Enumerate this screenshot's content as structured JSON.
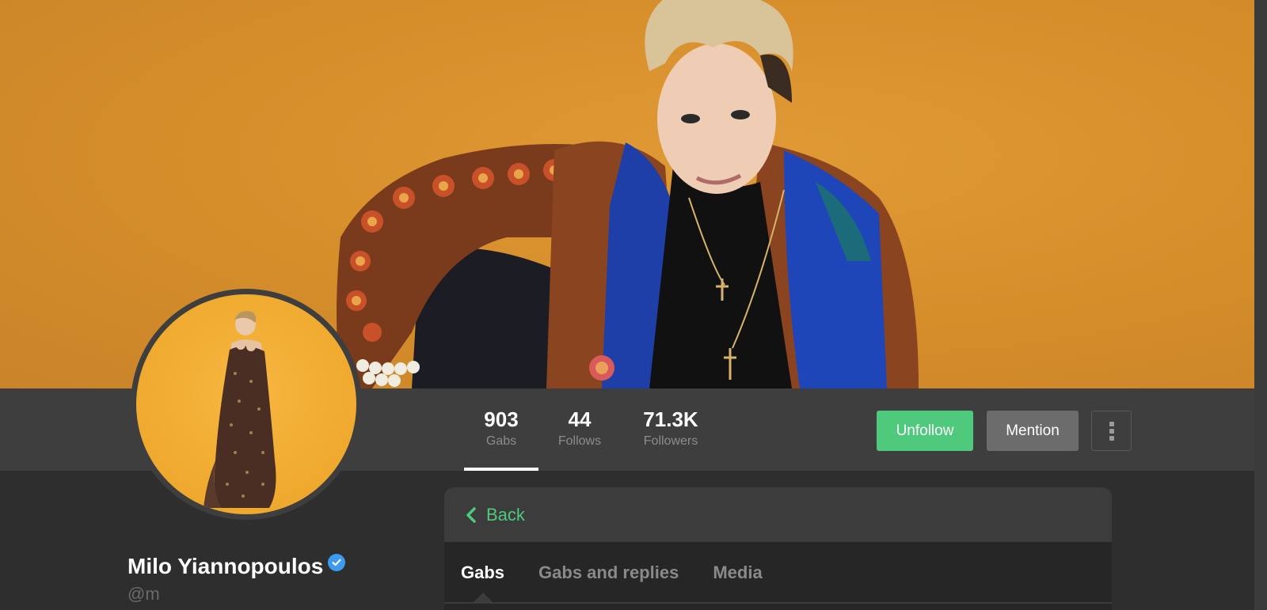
{
  "profile": {
    "display_name": "Milo Yiannopoulos",
    "handle": "@m",
    "verified": true
  },
  "stats": [
    {
      "value": "903",
      "label": "Gabs",
      "active": true
    },
    {
      "value": "44",
      "label": "Follows",
      "active": false
    },
    {
      "value": "71.3K",
      "label": "Followers",
      "active": false
    }
  ],
  "actions": {
    "unfollow_label": "Unfollow",
    "mention_label": "Mention",
    "more_icon": "more-vertical-icon"
  },
  "feed": {
    "back_label": "Back",
    "tabs": [
      {
        "label": "Gabs",
        "active": true
      },
      {
        "label": "Gabs and replies",
        "active": false
      },
      {
        "label": "Media",
        "active": false
      }
    ]
  },
  "colors": {
    "accent": "#4fc97b",
    "cover_bg": "#d58d2a",
    "verified": "#3d9bef"
  }
}
